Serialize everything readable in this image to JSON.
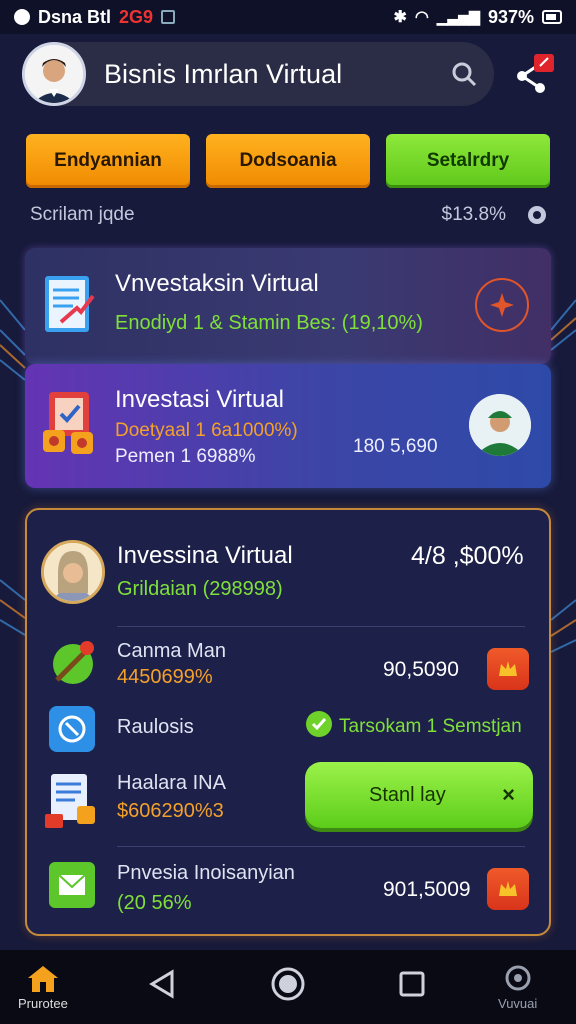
{
  "status_bar": {
    "carrier": "Dsna Btl",
    "red_text": "2G9",
    "battery": "937%"
  },
  "header": {
    "title": "Bisnis Imrlan Virtual"
  },
  "tabs": [
    {
      "label": "Endyannian"
    },
    {
      "label": "Dodsoania"
    },
    {
      "label": "Setalrdry"
    }
  ],
  "sub_row": {
    "label": "Scrilam jqde",
    "value": "$13.8%"
  },
  "card1": {
    "title": "Vnvestaksin Virtual",
    "subtitle": "Enodiyd 1 & Stamin Bes: (19,10%)"
  },
  "card2": {
    "title": "Investasi Virtual",
    "line1": "Doetyaal 1 6a1000%)",
    "line2": "Pemen 1 6988%",
    "value": "180 5,690"
  },
  "card3": {
    "title": "Invessina Virtual",
    "subtitle": "Grildaian (298998)",
    "value": "4/8 ,$00%",
    "rows": [
      {
        "title": "Canma Man",
        "sub": "4450699%",
        "value": "90,5090"
      },
      {
        "title": "Raulosis",
        "status": "Tarsokam 1 Semstjan"
      },
      {
        "title": "Haalara INA",
        "sub": "$606290%3",
        "button": "Stanl lay",
        "button_x": "×"
      },
      {
        "title": "Pnvesia Inoisanyian",
        "sub": "(20 56%",
        "value": "901,5009"
      }
    ]
  },
  "nav": {
    "home_label": "Prurotee",
    "right_label": "Vuvuai"
  },
  "colors": {
    "background": "#171a3a",
    "accent_orange": "#f3a12b",
    "accent_green": "#7fe03a"
  }
}
